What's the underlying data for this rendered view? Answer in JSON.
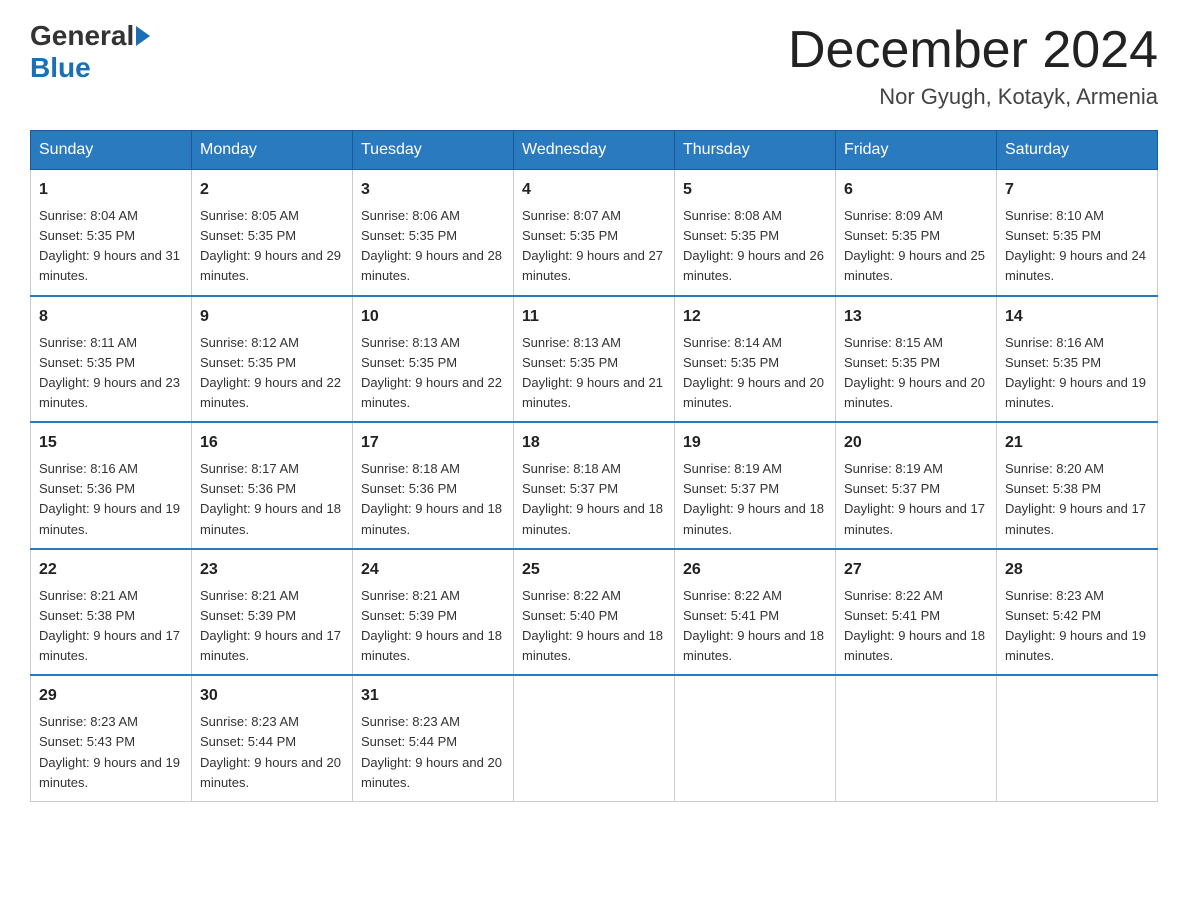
{
  "header": {
    "logo_general": "General",
    "logo_blue": "Blue",
    "month_title": "December 2024",
    "subtitle": "Nor Gyugh, Kotayk, Armenia"
  },
  "days_of_week": [
    "Sunday",
    "Monday",
    "Tuesday",
    "Wednesday",
    "Thursday",
    "Friday",
    "Saturday"
  ],
  "weeks": [
    [
      {
        "day": "1",
        "sunrise": "8:04 AM",
        "sunset": "5:35 PM",
        "daylight": "9 hours and 31 minutes."
      },
      {
        "day": "2",
        "sunrise": "8:05 AM",
        "sunset": "5:35 PM",
        "daylight": "9 hours and 29 minutes."
      },
      {
        "day": "3",
        "sunrise": "8:06 AM",
        "sunset": "5:35 PM",
        "daylight": "9 hours and 28 minutes."
      },
      {
        "day": "4",
        "sunrise": "8:07 AM",
        "sunset": "5:35 PM",
        "daylight": "9 hours and 27 minutes."
      },
      {
        "day": "5",
        "sunrise": "8:08 AM",
        "sunset": "5:35 PM",
        "daylight": "9 hours and 26 minutes."
      },
      {
        "day": "6",
        "sunrise": "8:09 AM",
        "sunset": "5:35 PM",
        "daylight": "9 hours and 25 minutes."
      },
      {
        "day": "7",
        "sunrise": "8:10 AM",
        "sunset": "5:35 PM",
        "daylight": "9 hours and 24 minutes."
      }
    ],
    [
      {
        "day": "8",
        "sunrise": "8:11 AM",
        "sunset": "5:35 PM",
        "daylight": "9 hours and 23 minutes."
      },
      {
        "day": "9",
        "sunrise": "8:12 AM",
        "sunset": "5:35 PM",
        "daylight": "9 hours and 22 minutes."
      },
      {
        "day": "10",
        "sunrise": "8:13 AM",
        "sunset": "5:35 PM",
        "daylight": "9 hours and 22 minutes."
      },
      {
        "day": "11",
        "sunrise": "8:13 AM",
        "sunset": "5:35 PM",
        "daylight": "9 hours and 21 minutes."
      },
      {
        "day": "12",
        "sunrise": "8:14 AM",
        "sunset": "5:35 PM",
        "daylight": "9 hours and 20 minutes."
      },
      {
        "day": "13",
        "sunrise": "8:15 AM",
        "sunset": "5:35 PM",
        "daylight": "9 hours and 20 minutes."
      },
      {
        "day": "14",
        "sunrise": "8:16 AM",
        "sunset": "5:35 PM",
        "daylight": "9 hours and 19 minutes."
      }
    ],
    [
      {
        "day": "15",
        "sunrise": "8:16 AM",
        "sunset": "5:36 PM",
        "daylight": "9 hours and 19 minutes."
      },
      {
        "day": "16",
        "sunrise": "8:17 AM",
        "sunset": "5:36 PM",
        "daylight": "9 hours and 18 minutes."
      },
      {
        "day": "17",
        "sunrise": "8:18 AM",
        "sunset": "5:36 PM",
        "daylight": "9 hours and 18 minutes."
      },
      {
        "day": "18",
        "sunrise": "8:18 AM",
        "sunset": "5:37 PM",
        "daylight": "9 hours and 18 minutes."
      },
      {
        "day": "19",
        "sunrise": "8:19 AM",
        "sunset": "5:37 PM",
        "daylight": "9 hours and 18 minutes."
      },
      {
        "day": "20",
        "sunrise": "8:19 AM",
        "sunset": "5:37 PM",
        "daylight": "9 hours and 17 minutes."
      },
      {
        "day": "21",
        "sunrise": "8:20 AM",
        "sunset": "5:38 PM",
        "daylight": "9 hours and 17 minutes."
      }
    ],
    [
      {
        "day": "22",
        "sunrise": "8:21 AM",
        "sunset": "5:38 PM",
        "daylight": "9 hours and 17 minutes."
      },
      {
        "day": "23",
        "sunrise": "8:21 AM",
        "sunset": "5:39 PM",
        "daylight": "9 hours and 17 minutes."
      },
      {
        "day": "24",
        "sunrise": "8:21 AM",
        "sunset": "5:39 PM",
        "daylight": "9 hours and 18 minutes."
      },
      {
        "day": "25",
        "sunrise": "8:22 AM",
        "sunset": "5:40 PM",
        "daylight": "9 hours and 18 minutes."
      },
      {
        "day": "26",
        "sunrise": "8:22 AM",
        "sunset": "5:41 PM",
        "daylight": "9 hours and 18 minutes."
      },
      {
        "day": "27",
        "sunrise": "8:22 AM",
        "sunset": "5:41 PM",
        "daylight": "9 hours and 18 minutes."
      },
      {
        "day": "28",
        "sunrise": "8:23 AM",
        "sunset": "5:42 PM",
        "daylight": "9 hours and 19 minutes."
      }
    ],
    [
      {
        "day": "29",
        "sunrise": "8:23 AM",
        "sunset": "5:43 PM",
        "daylight": "9 hours and 19 minutes."
      },
      {
        "day": "30",
        "sunrise": "8:23 AM",
        "sunset": "5:44 PM",
        "daylight": "9 hours and 20 minutes."
      },
      {
        "day": "31",
        "sunrise": "8:23 AM",
        "sunset": "5:44 PM",
        "daylight": "9 hours and 20 minutes."
      },
      null,
      null,
      null,
      null
    ]
  ]
}
